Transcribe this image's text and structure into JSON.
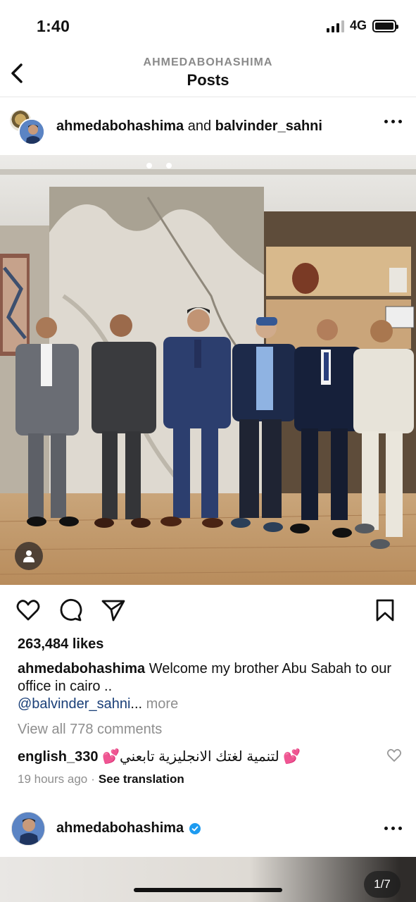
{
  "status": {
    "time": "1:40",
    "network": "4G",
    "battery_level": 1.0
  },
  "header": {
    "username": "AHMEDABOHASHIMA",
    "title": "Posts"
  },
  "post": {
    "author_1": "ahmedabohashima",
    "and_word": " and ",
    "author_2": "balvinder_sahni",
    "likes": "263,484 likes",
    "caption_user": "ahmedabohashima",
    "caption_text": " Welcome my brother Abu Sabah to our office in cairo ..",
    "caption_mention": "@balvinder_sahni",
    "caption_ellipsis": "...",
    "more_label": " more",
    "view_comments": "View all 778 comments",
    "comment_user": "english_330",
    "comment_text": " 💕لتنمية لغتك الانجليزية تابعني 💕",
    "time_ago": "19 hours ago",
    "separator": "·",
    "see_translation": "See translation"
  },
  "next_post": {
    "username": "ahmedabohashima",
    "counter": "1/7"
  },
  "icons": {
    "back": "chevron-left-icon",
    "more": "more-horizontal-icon",
    "like": "heart-icon",
    "comment": "comment-icon",
    "share": "send-icon",
    "save": "bookmark-icon",
    "tag": "person-icon",
    "verified": "verified-badge-icon"
  },
  "colors": {
    "mention": "#1a3f78",
    "muted": "#8e8e8e",
    "verified": "#1d9bf0"
  }
}
